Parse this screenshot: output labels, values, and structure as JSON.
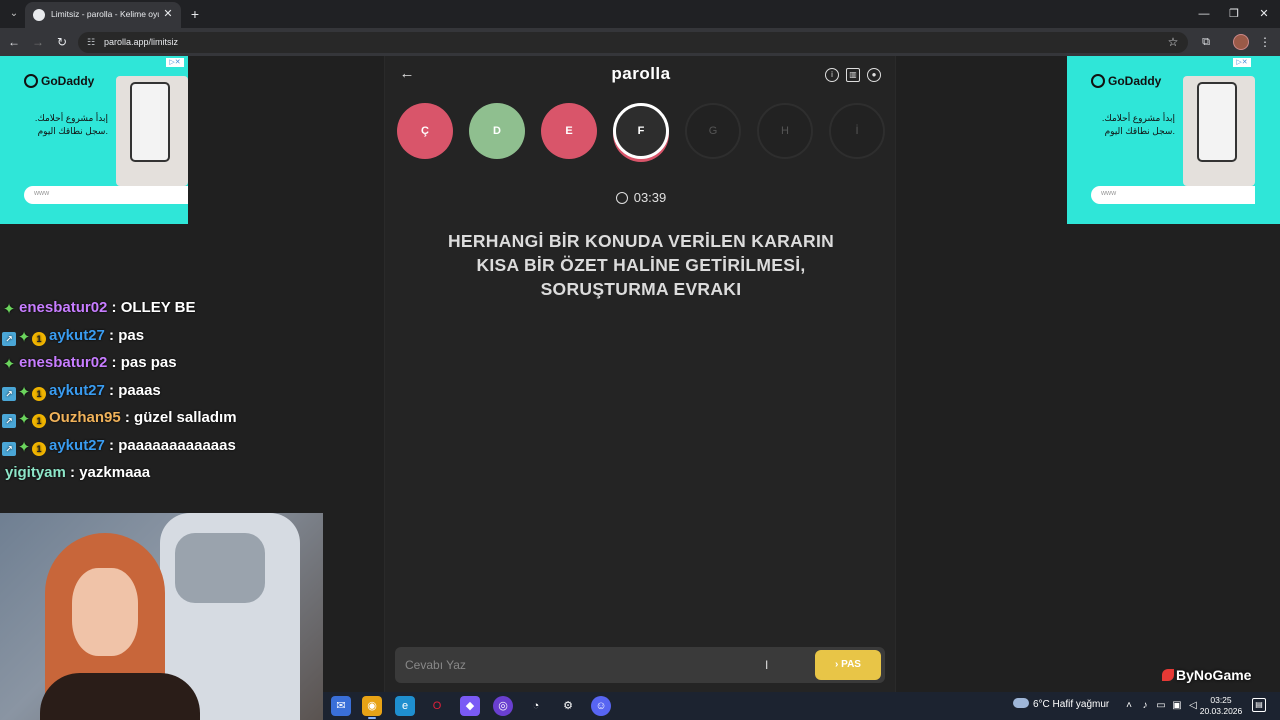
{
  "browser": {
    "tab_title": "Limitsiz - parolla - Kelime oyunu",
    "url": "parolla.app/limitsiz"
  },
  "ads": {
    "brand": "GoDaddy",
    "text": "إبدأ مشروع أحلامك. سجل نطاقك اليوم.",
    "input_placeholder": "www"
  },
  "game": {
    "title": "parolla",
    "letters": [
      {
        "letter": "Ç",
        "state": "wrong"
      },
      {
        "letter": "D",
        "state": "right"
      },
      {
        "letter": "E",
        "state": "wrong"
      },
      {
        "letter": "F",
        "state": "current"
      },
      {
        "letter": "G",
        "state": "pending"
      },
      {
        "letter": "H",
        "state": "pending"
      },
      {
        "letter": "İ",
        "state": "pending"
      }
    ],
    "timer": "03:39",
    "question": "HERHANGİ BİR KONUDA VERİLEN KARARIN KISA BİR ÖZET HALİNE GETİRİLMESİ, SORUŞTURMA EVRAKI",
    "answer_placeholder": "Cevabı Yaz",
    "pass_label": "PAS"
  },
  "chat": [
    {
      "user": "enesbatur02",
      "message": "OLLEY BE",
      "user_color": "#c77dff",
      "badges": [
        "green"
      ]
    },
    {
      "user": "aykut27",
      "message": "pas",
      "user_color": "#3a9cf0",
      "badges": [
        "blue",
        "green",
        "gold"
      ]
    },
    {
      "user": "enesbatur02",
      "message": "pas pas",
      "user_color": "#c77dff",
      "badges": [
        "green"
      ]
    },
    {
      "user": "aykut27",
      "message": "paaas",
      "user_color": "#3a9cf0",
      "badges": [
        "blue",
        "green",
        "gold"
      ]
    },
    {
      "user": "Ouzhan95",
      "message": "güzel salladım",
      "user_color": "#f0b25a",
      "badges": [
        "blue",
        "green",
        "gold"
      ]
    },
    {
      "user": "aykut27",
      "message": "paaaaaaaaaaaas",
      "user_color": "#3a9cf0",
      "badges": [
        "blue",
        "green",
        "gold"
      ]
    },
    {
      "user": "yigityam",
      "message": "yazkmaaa",
      "user_color": "#8de6c8",
      "badges": []
    }
  ],
  "watermark": "ByNoGame",
  "taskbar": {
    "weather": "6°C  Hafif yağmur",
    "time": "03:25",
    "date": "20.03.2026"
  },
  "colors": {
    "wrong": "#d9556a",
    "right": "#8fbf8f",
    "pass_button": "#e8c547",
    "ad_background": "#2fe6d8"
  }
}
